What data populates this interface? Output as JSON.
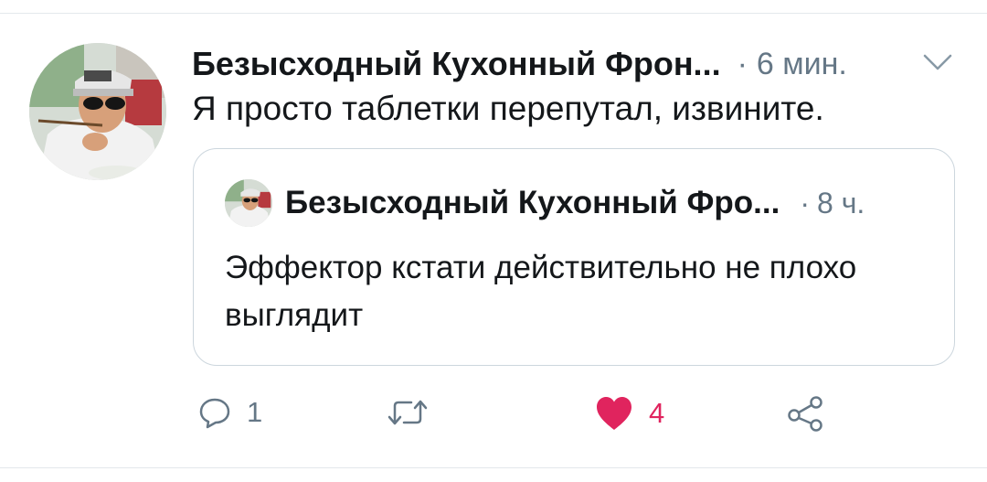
{
  "tweet": {
    "author_name": "Безысходный Кухонный Фрон...",
    "separator": "·",
    "timestamp": "6 мин.",
    "text": "Я просто таблетки перепутал, извините."
  },
  "quoted": {
    "author_name": "Безысходный Кухонный Фро...",
    "separator": "·",
    "timestamp": "8 ч.",
    "text": "Эффектор кстати действительно не плохо выглядит"
  },
  "actions": {
    "reply_count": "1",
    "retweet_count": "",
    "like_count": "4",
    "liked": true
  },
  "colors": {
    "text": "#14171a",
    "secondary": "#657786",
    "like": "#e0245e",
    "border": "#ccd6dd"
  },
  "icons": [
    "caret-down-icon",
    "reply-icon",
    "retweet-icon",
    "heart-icon",
    "share-icon"
  ]
}
